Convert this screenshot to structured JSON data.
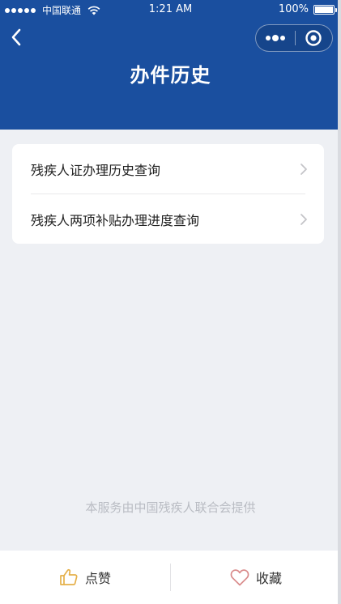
{
  "status_bar": {
    "carrier": "中国联通",
    "time": "1:21 AM",
    "battery": "100%"
  },
  "nav": {
    "title": "办件历史"
  },
  "menu": {
    "items": [
      {
        "label": "残疾人证办理历史查询"
      },
      {
        "label": "残疾人两项补贴办理进度查询"
      }
    ]
  },
  "footer": {
    "note": "本服务由中国残疾人联合会提供"
  },
  "bottom_bar": {
    "like_label": "点赞",
    "favorite_label": "收藏"
  },
  "colors": {
    "header_bg": "#1a4f9f",
    "page_bg": "#eef0f4",
    "like_icon": "#e5b04a",
    "favorite_icon": "#d98a8a"
  }
}
